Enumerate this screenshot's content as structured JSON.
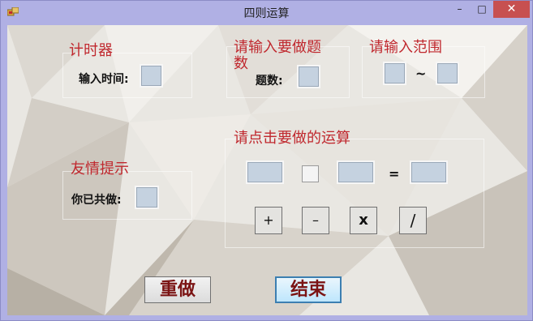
{
  "window": {
    "title": "四则运算"
  },
  "controls": {
    "minimize": "–",
    "maximize": "□",
    "close": "✕"
  },
  "timer": {
    "heading": "计时器",
    "input_label": "输入时间:",
    "input_value": ""
  },
  "questions": {
    "heading": "请输入要做题数",
    "count_label": "题数:",
    "count_value": ""
  },
  "range": {
    "heading": "请输入范围",
    "from_value": "",
    "separator": "~",
    "to_value": ""
  },
  "hint": {
    "heading": "友情提示",
    "done_label": "你已共做:",
    "done_value": ""
  },
  "operation": {
    "heading": "请点击要做的运算",
    "operand1": "",
    "operand2": "",
    "equals": "=",
    "result": "",
    "ops": [
      "+",
      "–",
      "x",
      "/"
    ]
  },
  "actions": {
    "redo": "重做",
    "finish": "结束"
  },
  "colors": {
    "heading_red": "#c0282e",
    "button_text": "#7b1414",
    "textbox_fill": "#c5d2e0",
    "window_frame": "#b0b0e4",
    "close_red": "#c75050"
  }
}
